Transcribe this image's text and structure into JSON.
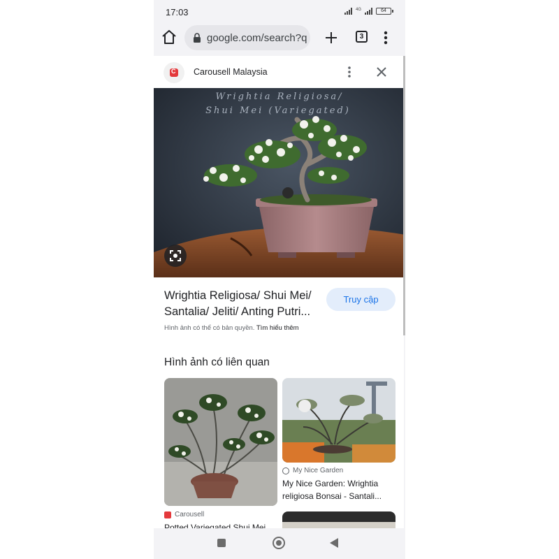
{
  "status_bar": {
    "time": "17:03",
    "network_label": "4G",
    "battery_level": "64"
  },
  "browser": {
    "url": "google.com/search?q",
    "tab_count": "3",
    "icons": [
      "home-icon",
      "lock-icon",
      "plus-icon",
      "tabs-icon",
      "more-vert-icon"
    ]
  },
  "result": {
    "source_name": "Carousell Malaysia",
    "image_watermark": "Wrightia Religiosa/ Shui Mei (Variegated)",
    "title": "Wrightia Religiosa/ Shui Mei/ Santalia/ Jeliti/ Anting Putri...",
    "visit_label": "Truy cập",
    "copyright_text": "Hình ảnh có thể có bản quyền.",
    "learn_more_label": "Tìm hiểu thêm"
  },
  "related": {
    "heading": "Hình ảnh có liên quan",
    "items": [
      {
        "source": "Carousell",
        "caption": "Potted Variegated Shui Mei"
      },
      {
        "source": "My Nice Garden",
        "caption": "My Nice Garden: Wrightia religiosa Bonsai - Santali..."
      }
    ]
  },
  "colors": {
    "accent_blue": "#1a73e8",
    "visit_button_bg": "#e3edfb",
    "carousell_red": "#e4393c",
    "chrome_bg": "#f3f3f6"
  }
}
